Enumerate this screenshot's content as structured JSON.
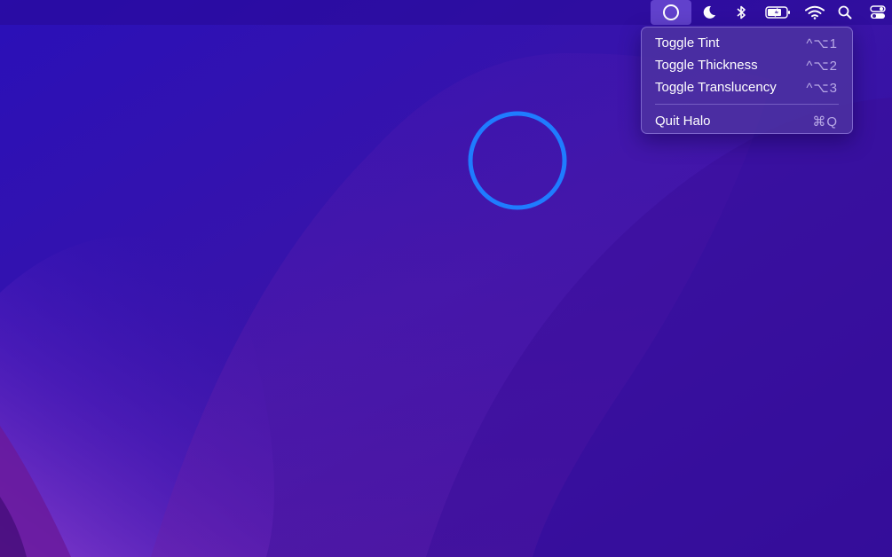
{
  "colors": {
    "halo_ring": "#1f7cff",
    "menubar_bg": "#2c0f9a",
    "menu_bg": "#4e34a0"
  },
  "menubar": {
    "items": [
      {
        "icon": "halo-circle-icon",
        "active": true
      },
      {
        "icon": "moon-icon"
      },
      {
        "icon": "bluetooth-icon"
      },
      {
        "icon": "battery-charging-icon"
      },
      {
        "icon": "wifi-icon"
      },
      {
        "icon": "search-icon"
      },
      {
        "icon": "control-center-icon"
      }
    ]
  },
  "menu": {
    "items": [
      {
        "label": "Toggle Tint",
        "shortcut": "^⌥1"
      },
      {
        "label": "Toggle Thickness",
        "shortcut": "^⌥2"
      },
      {
        "label": "Toggle Translucency",
        "shortcut": "^⌥3"
      }
    ],
    "quit": {
      "label": "Quit Halo",
      "shortcut": "⌘Q"
    }
  }
}
